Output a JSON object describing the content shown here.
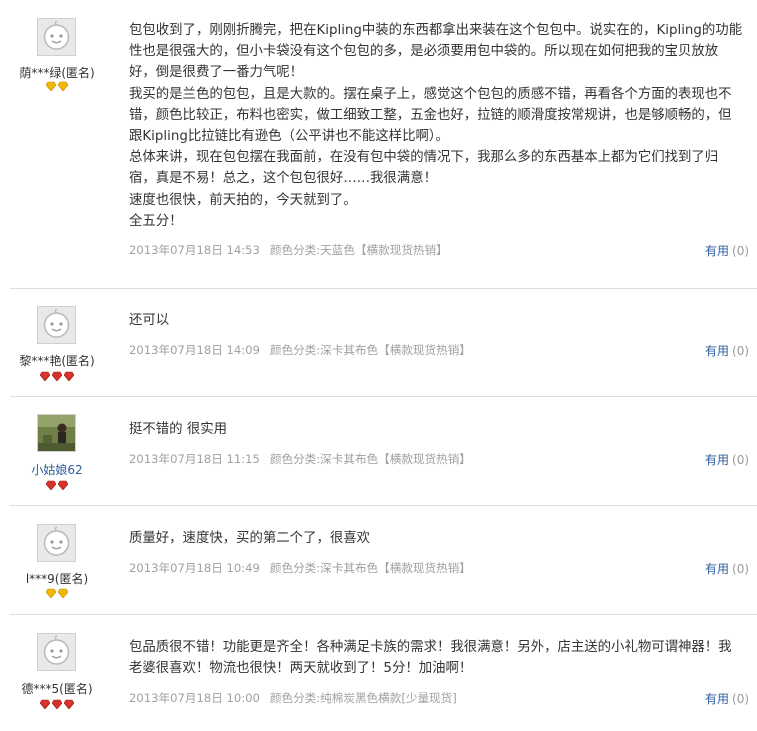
{
  "reviews": [
    {
      "user": "荫***绿(匿名)",
      "lines": [
        "包包收到了，刚刚折腾完，把在Kipling中装的东西都拿出来装在这个包包中。说实在的，Kipling的功能",
        "性也是很强大的，但小卡袋没有这个包包的多，是必须要用包中袋的。所以现在如何把我的宝贝放放",
        "好，倒是很费了一番力气呢！",
        "我买的是兰色的包包，且是大款的。摆在桌子上，感觉这个包包的质感不错，再看各个方面的表现也不",
        "错，颜色比较正，布料也密实，做工细致工整，五金也好，拉链的顺滑度按常规讲，也是够顺畅的，但",
        "跟Kipling比拉链比有逊色（公平讲也不能这样比啊）。",
        "总体来讲，现在包包摆在我面前，在没有包中袋的情况下，我那么多的东西基本上都为它们找到了归",
        "宿，真是不易！总之，这个包包很好……我很满意！",
        "速度也很快，前天拍的，今天就到了。",
        "全五分！"
      ],
      "date": "2013年07月18日 14:53",
      "spec": "颜色分类:天蓝色【横款现货热销】",
      "helpful_label": "有用",
      "helpful_count": "(0)",
      "badge": "gold"
    },
    {
      "user": "黎***艳(匿名)",
      "lines": [
        "还可以"
      ],
      "date": "2013年07月18日 14:09",
      "spec": "颜色分类:深卡其布色【横款现货热销】",
      "helpful_label": "有用",
      "helpful_count": "(0)",
      "badge": "red3"
    },
    {
      "user": "小姑娘62",
      "lines": [
        "挺不错的 很实用"
      ],
      "date": "2013年07月18日 11:15",
      "spec": "颜色分类:深卡其布色【横款现货热销】",
      "helpful_label": "有用",
      "helpful_count": "(0)",
      "badge": "red2"
    },
    {
      "user": "l***9(匿名)",
      "lines": [
        "质量好，速度快，买的第二个了，很喜欢"
      ],
      "date": "2013年07月18日 10:49",
      "spec": "颜色分类:深卡其布色【横款现货热销】",
      "helpful_label": "有用",
      "helpful_count": "(0)",
      "badge": "gold"
    },
    {
      "user": "德***5(匿名)",
      "lines": [
        "包品质很不错！功能更是齐全！各种满足卡族的需求！我很满意！另外，店主送的小礼物可谓神器！我",
        "老婆很喜欢！物流也很快！两天就收到了！5分！加油啊！"
      ],
      "date": "2013年07月18日 10:00",
      "spec": "颜色分类:纯棉炭黑色横款[少量现货]",
      "helpful_label": "有用",
      "helpful_count": "(0)",
      "badge": "red3"
    }
  ],
  "colors": {
    "link": "#2d5fa0",
    "meta": "#a0a0a0",
    "text": "#333333",
    "gold_badge": "#f2b705",
    "red_badge": "#d8332a"
  },
  "icons": {
    "default_avatar": "default-avatar-face-icon",
    "gold_badge": "gold-diamond-icon",
    "red_badge": "red-heart-diamond-icon"
  }
}
